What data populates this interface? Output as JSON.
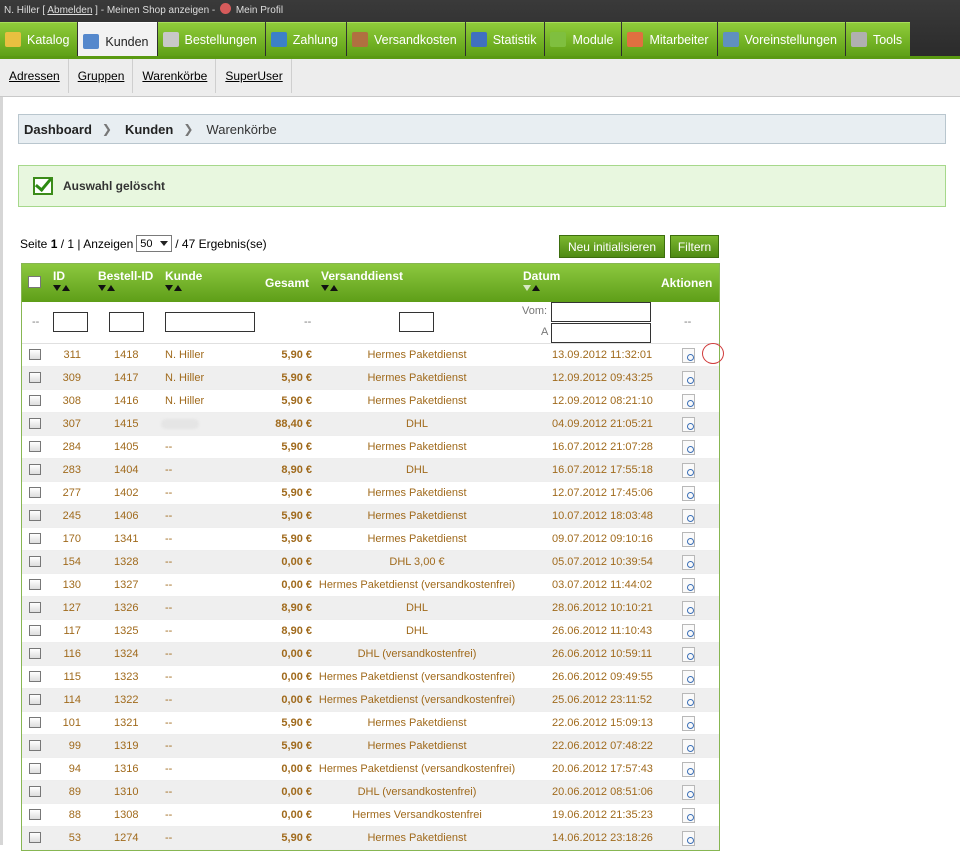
{
  "topbar": {
    "user": "N. Hiller [",
    "logout": "Abmelden",
    "mid": "] - Meinen Shop anzeigen -",
    "profile": "Mein Profil"
  },
  "tabs": [
    {
      "label": "Katalog",
      "color": "#e8c040"
    },
    {
      "label": "Kunden",
      "color": "#5588cc"
    },
    {
      "label": "Bestellungen",
      "color": "#c8c8c8"
    },
    {
      "label": "Zahlung",
      "color": "#3c80c8"
    },
    {
      "label": "Versandkosten",
      "color": "#b07040"
    },
    {
      "label": "Statistik",
      "color": "#4070c0"
    },
    {
      "label": "Module",
      "color": "#7fbf3f"
    },
    {
      "label": "Mitarbeiter",
      "color": "#e07040"
    },
    {
      "label": "Voreinstellungen",
      "color": "#6090c0"
    },
    {
      "label": "Tools",
      "color": "#b0b0b0"
    }
  ],
  "subnav": [
    "Adressen",
    "Gruppen",
    "Warenkörbe",
    "SuperUser"
  ],
  "breadcrumb": {
    "a": "Dashboard",
    "b": "Kunden",
    "c": "Warenkörbe"
  },
  "notice": "Auswahl gelöscht",
  "pager": {
    "seite": "Seite",
    "page": "1",
    "of": "/ 1 | Anzeigen",
    "per": "50",
    "total": "/ 47 Ergebnis(se)"
  },
  "buttons": {
    "reset": "Neu initialisieren",
    "filter": "Filtern"
  },
  "headers": {
    "id": "ID",
    "bestell": "Bestell-ID",
    "kunde": "Kunde",
    "gesamt": "Gesamt",
    "versand": "Versanddienst",
    "datum": "Datum",
    "aktionen": "Aktionen"
  },
  "filter": {
    "dash": "--",
    "vom": "Vom:",
    "a": "A"
  },
  "rows": [
    {
      "id": "311",
      "bid": "1418",
      "kunde": "N. Hiller",
      "gesamt": "5,90 €",
      "versand": "Hermes Paketdienst",
      "datum": "13.09.2012 11:32:01"
    },
    {
      "id": "309",
      "bid": "1417",
      "kunde": "N. Hiller",
      "gesamt": "5,90 €",
      "versand": "Hermes Paketdienst",
      "datum": "12.09.2012 09:43:25"
    },
    {
      "id": "308",
      "bid": "1416",
      "kunde": "N. Hiller",
      "gesamt": "5,90 €",
      "versand": "Hermes Paketdienst",
      "datum": "12.09.2012 08:21:10"
    },
    {
      "id": "307",
      "bid": "1415",
      "kunde": "",
      "gesamt": "88,40 €",
      "versand": "DHL",
      "datum": "04.09.2012 21:05:21"
    },
    {
      "id": "284",
      "bid": "1405",
      "kunde": "--",
      "gesamt": "5,90 €",
      "versand": "Hermes Paketdienst",
      "datum": "16.07.2012 21:07:28"
    },
    {
      "id": "283",
      "bid": "1404",
      "kunde": "--",
      "gesamt": "8,90 €",
      "versand": "DHL",
      "datum": "16.07.2012 17:55:18"
    },
    {
      "id": "277",
      "bid": "1402",
      "kunde": "--",
      "gesamt": "5,90 €",
      "versand": "Hermes Paketdienst",
      "datum": "12.07.2012 17:45:06"
    },
    {
      "id": "245",
      "bid": "1406",
      "kunde": "--",
      "gesamt": "5,90 €",
      "versand": "Hermes Paketdienst",
      "datum": "10.07.2012 18:03:48"
    },
    {
      "id": "170",
      "bid": "1341",
      "kunde": "--",
      "gesamt": "5,90 €",
      "versand": "Hermes Paketdienst",
      "datum": "09.07.2012 09:10:16"
    },
    {
      "id": "154",
      "bid": "1328",
      "kunde": "--",
      "gesamt": "0,00 €",
      "versand": "DHL 3,00 €",
      "datum": "05.07.2012 10:39:54"
    },
    {
      "id": "130",
      "bid": "1327",
      "kunde": "--",
      "gesamt": "0,00 €",
      "versand": "Hermes Paketdienst (versandkostenfrei)",
      "datum": "03.07.2012 11:44:02"
    },
    {
      "id": "127",
      "bid": "1326",
      "kunde": "--",
      "gesamt": "8,90 €",
      "versand": "DHL",
      "datum": "28.06.2012 10:10:21"
    },
    {
      "id": "117",
      "bid": "1325",
      "kunde": "--",
      "gesamt": "8,90 €",
      "versand": "DHL",
      "datum": "26.06.2012 11:10:43"
    },
    {
      "id": "116",
      "bid": "1324",
      "kunde": "--",
      "gesamt": "0,00 €",
      "versand": "DHL (versandkostenfrei)",
      "datum": "26.06.2012 10:59:11"
    },
    {
      "id": "115",
      "bid": "1323",
      "kunde": "--",
      "gesamt": "0,00 €",
      "versand": "Hermes Paketdienst (versandkostenfrei)",
      "datum": "26.06.2012 09:49:55"
    },
    {
      "id": "114",
      "bid": "1322",
      "kunde": "--",
      "gesamt": "0,00 €",
      "versand": "Hermes Paketdienst (versandkostenfrei)",
      "datum": "25.06.2012 23:11:52"
    },
    {
      "id": "101",
      "bid": "1321",
      "kunde": "--",
      "gesamt": "5,90 €",
      "versand": "Hermes Paketdienst",
      "datum": "22.06.2012 15:09:13"
    },
    {
      "id": "99",
      "bid": "1319",
      "kunde": "--",
      "gesamt": "5,90 €",
      "versand": "Hermes Paketdienst",
      "datum": "22.06.2012 07:48:22"
    },
    {
      "id": "94",
      "bid": "1316",
      "kunde": "--",
      "gesamt": "0,00 €",
      "versand": "Hermes Paketdienst (versandkostenfrei)",
      "datum": "20.06.2012 17:57:43"
    },
    {
      "id": "89",
      "bid": "1310",
      "kunde": "--",
      "gesamt": "0,00 €",
      "versand": "DHL (versandkostenfrei)",
      "datum": "20.06.2012 08:51:06"
    },
    {
      "id": "88",
      "bid": "1308",
      "kunde": "--",
      "gesamt": "0,00 €",
      "versand": "Hermes Versandkostenfrei",
      "datum": "19.06.2012 21:35:23"
    },
    {
      "id": "53",
      "bid": "1274",
      "kunde": "--",
      "gesamt": "5,90 €",
      "versand": "Hermes Paketdienst",
      "datum": "14.06.2012 23:18:26"
    }
  ]
}
